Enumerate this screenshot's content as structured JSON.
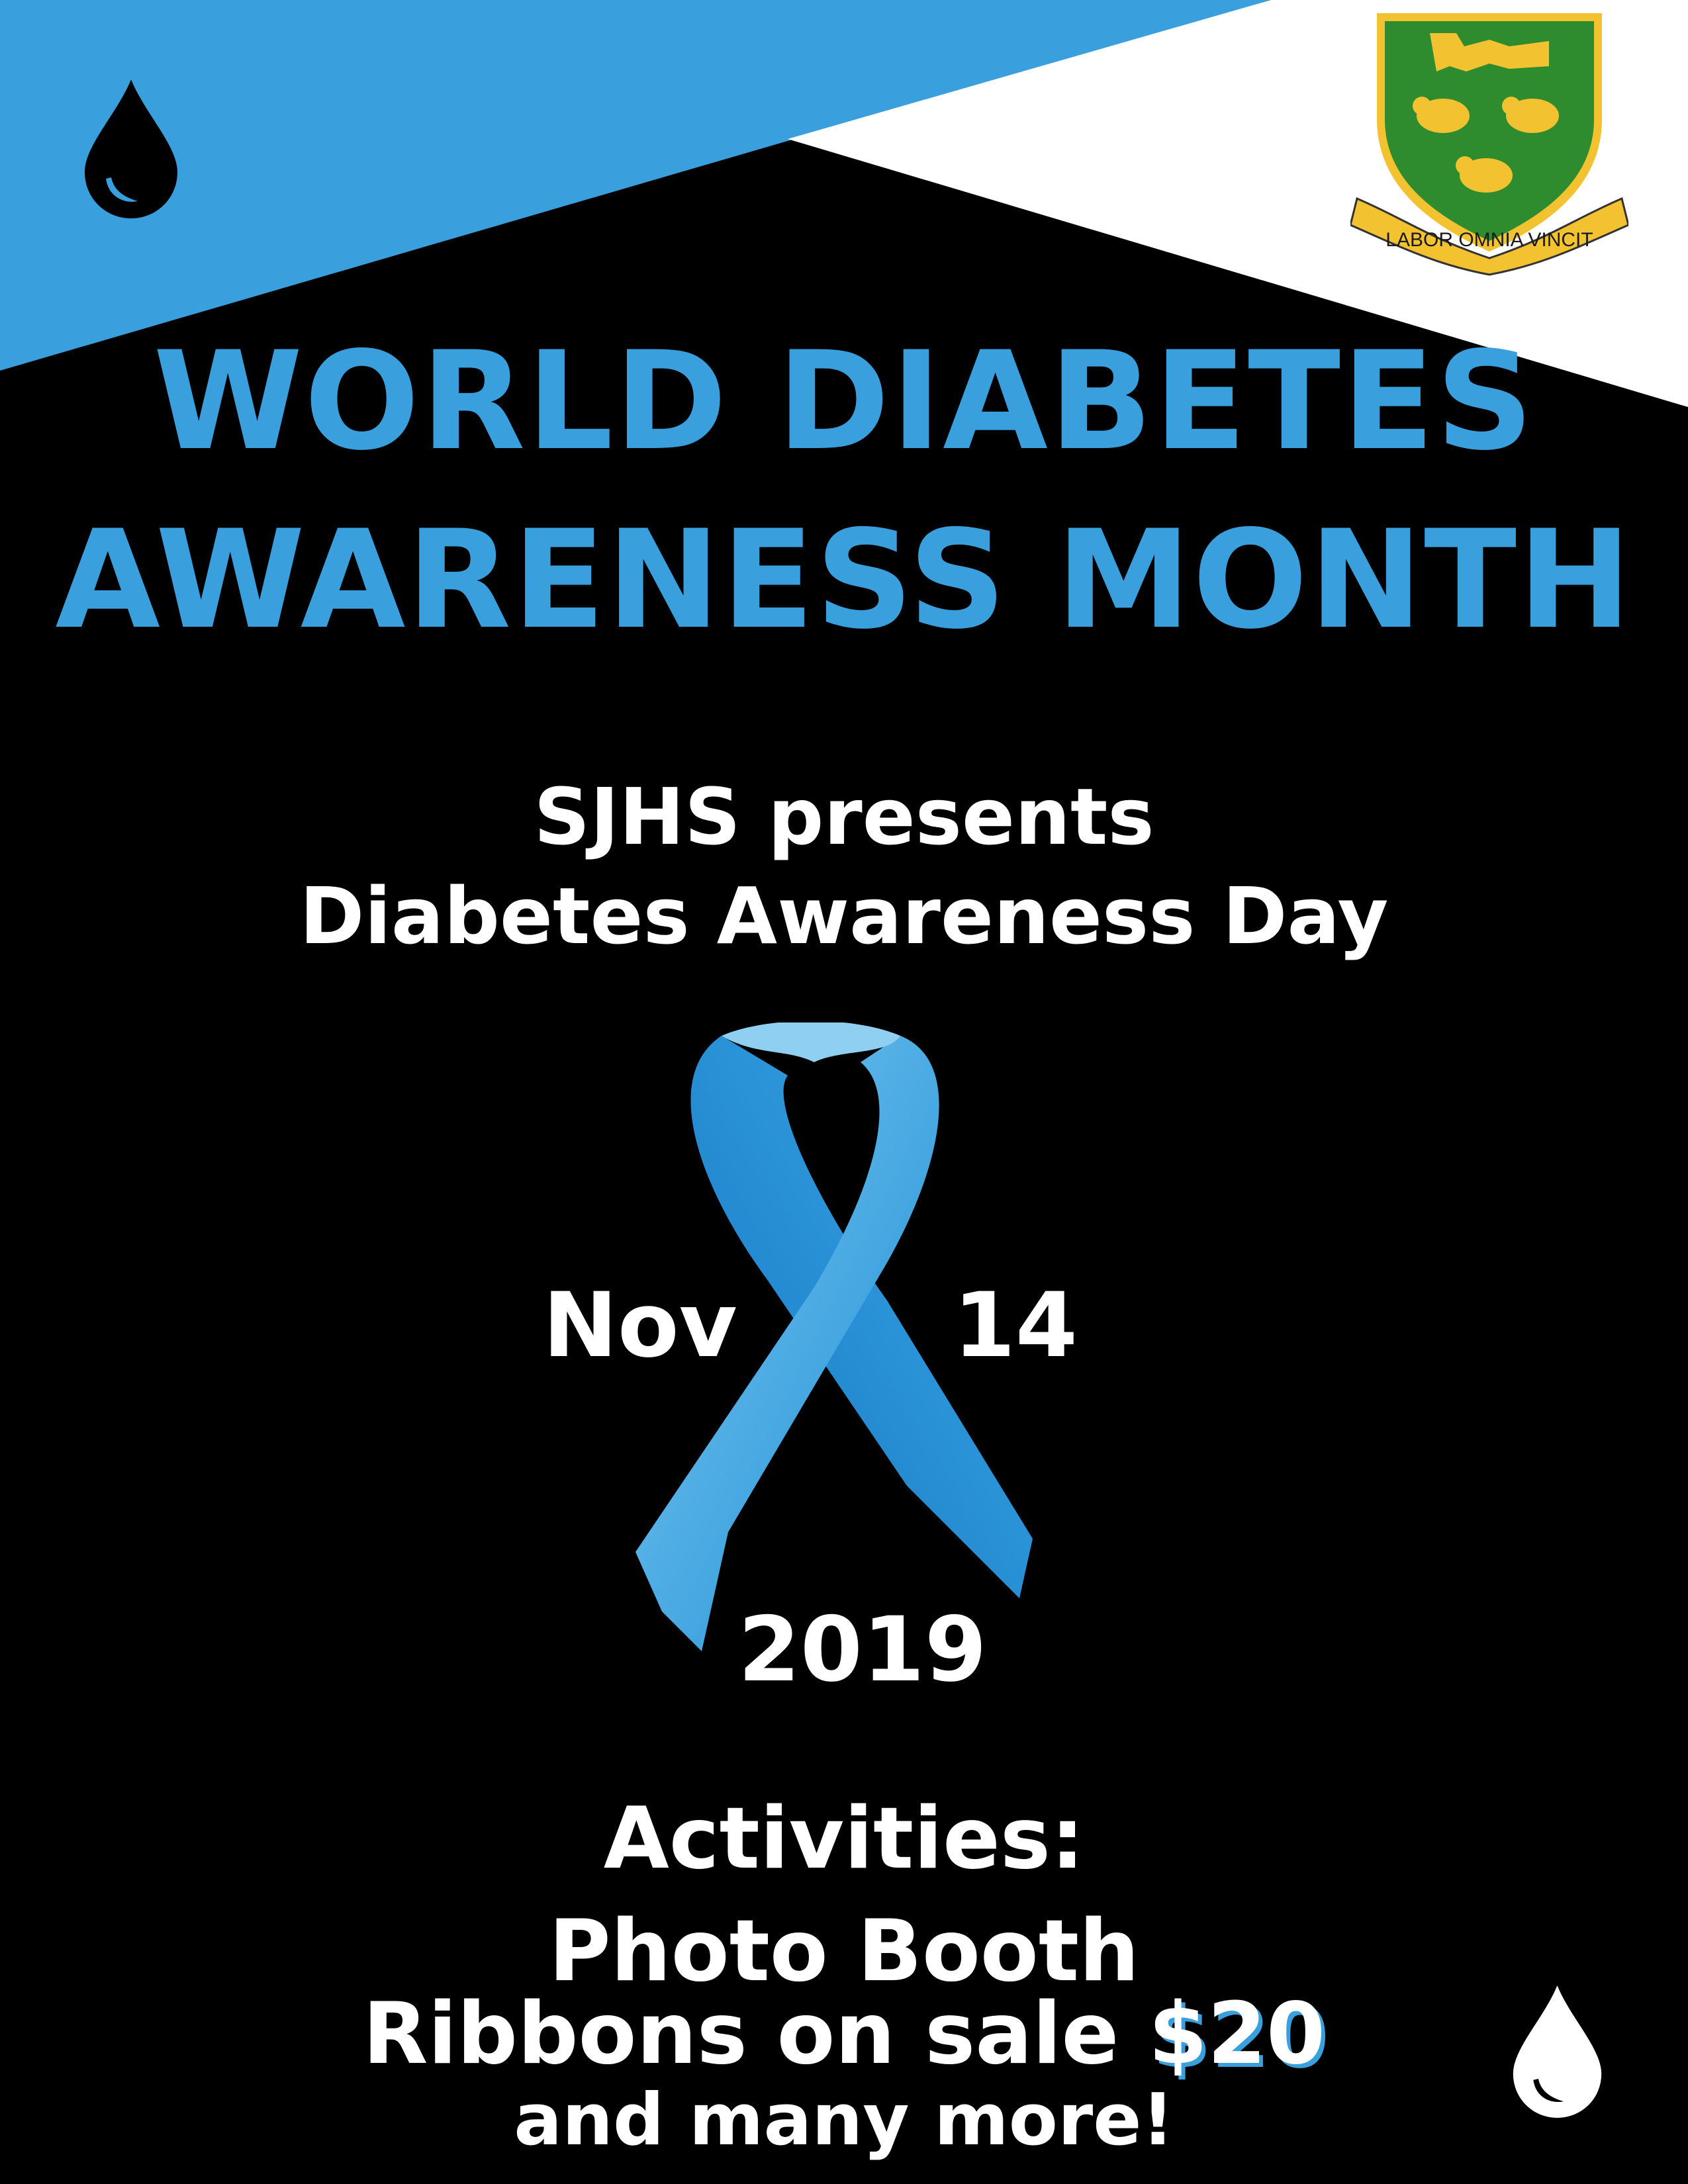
{
  "header": {
    "title_line1": "WORLD DIABETES",
    "title_line2": "AWARENESS MONTH"
  },
  "crest": {
    "motto": "LABOR OMNIA VINCIT"
  },
  "event": {
    "presenter_line": "SJHS presents",
    "event_name": "Diabetes Awareness Day",
    "date_month": "Nov",
    "date_day": "14",
    "date_year": "2019"
  },
  "activities": {
    "heading": "Activities:",
    "item1": "Photo Booth",
    "item2_text": "Ribbons on sale ",
    "item2_price": "$20",
    "closing": "and many more!"
  },
  "colors": {
    "background": "#000000",
    "accent_blue": "#3aa0dd",
    "text": "#ffffff",
    "crest_green": "#2e8b2e",
    "crest_gold": "#f2c230"
  },
  "icons": [
    "water-drop-icon",
    "awareness-ribbon-icon",
    "school-crest-icon"
  ]
}
